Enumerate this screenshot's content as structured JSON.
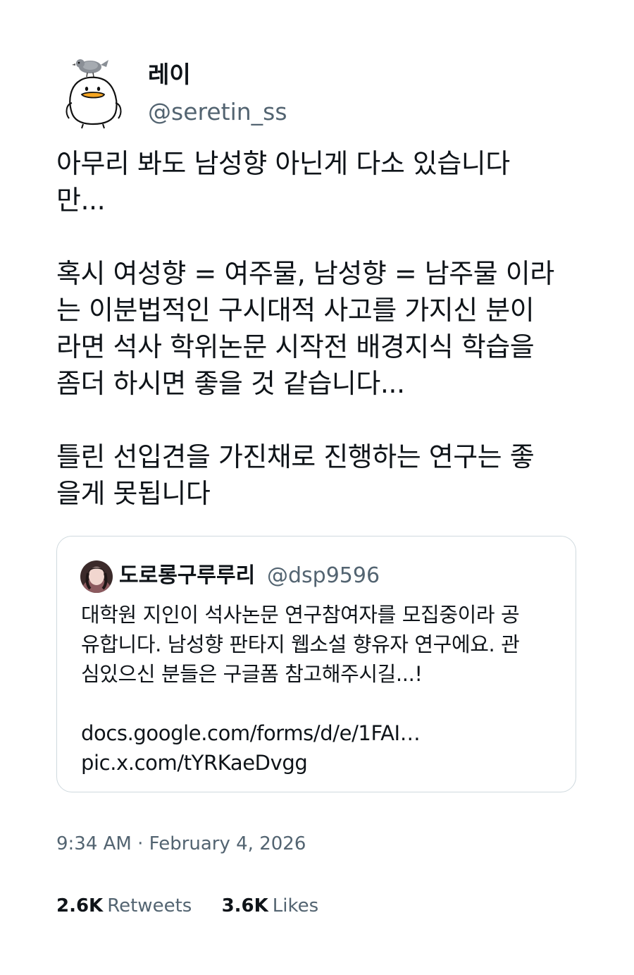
{
  "author": {
    "display_name": "레이",
    "handle": "@seretin_ss",
    "avatar_icon": "duck-with-pigeon-avatar-icon"
  },
  "tweet": {
    "paragraphs": [
      [
        "아무리 봐도 남성향 아닌게 다소 있습니다",
        "만..."
      ],
      [
        "혹시 여성향 = 여주물, 남성향 = 남주물 이라",
        "는 이분법적인 구시대적 사고를 가지신 분이",
        "라면 석사 학위논문 시작전 배경지식 학습을",
        "좀더 하시면 좋을 것 같습니다..."
      ],
      [
        "틀린 선입견을 가진채로 진행하는 연구는 좋",
        "을게 못됩니다"
      ]
    ]
  },
  "quoted_tweet": {
    "display_name": "도로롱구루루리",
    "handle": "@dsp9596",
    "avatar_icon": "profile-photo-avatar-icon",
    "paragraphs": [
      [
        "대학원 지인이 석사논문 연구참여자를 모집중이라 공",
        "유합니다. 남성향 판타지 웹소설 향유자 연구에요. 관",
        "심있으신 분들은 구글폼 참고해주시길...!"
      ],
      [
        "docs.google.com/forms/d/e/1FAI…",
        "pic.x.com/tYRKaeDvgg"
      ]
    ]
  },
  "timestamp": "9:34 AM · February 4, 2026",
  "stats": {
    "retweets_count": "2.6K",
    "retweets_label": "Retweets",
    "likes_count": "3.6K",
    "likes_label": "Likes"
  },
  "colors": {
    "text_primary": "#0f1419",
    "text_secondary": "#536471",
    "card_border": "#cfd9de",
    "duck_beak": "#f5a623"
  }
}
